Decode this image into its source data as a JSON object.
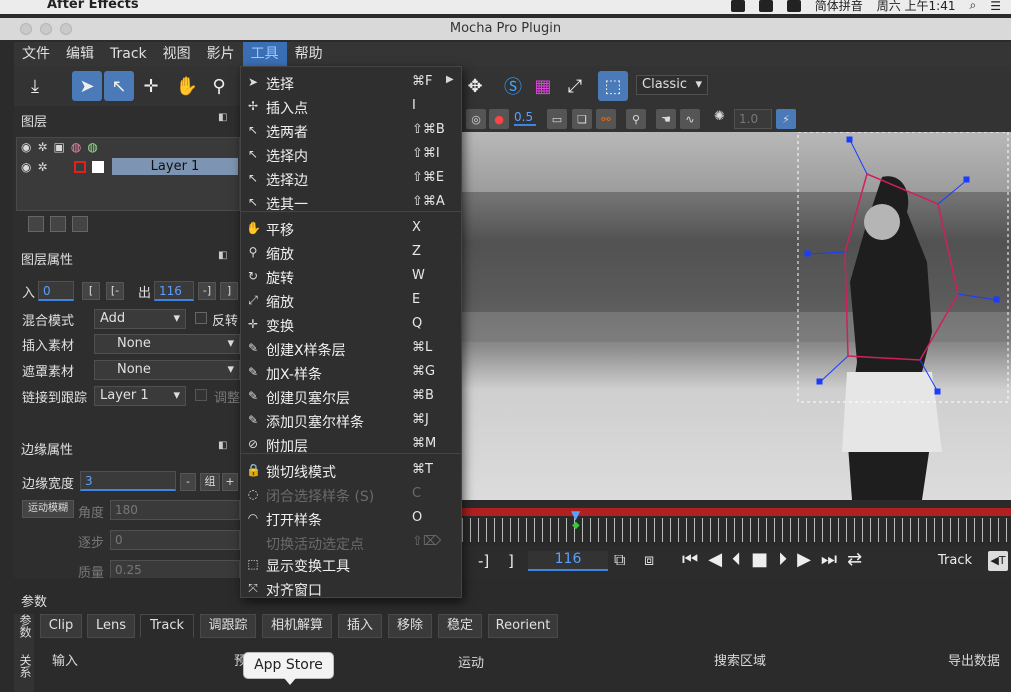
{
  "macos": {
    "app_name": "After Effects",
    "input_method": "简体拼音",
    "clock": "周六 上午1:41"
  },
  "window": {
    "title": "Mocha Pro Plugin"
  },
  "app_menu": [
    "文件",
    "编辑",
    "Track",
    "视图",
    "影片",
    "工具",
    "帮助"
  ],
  "toolbar": {
    "view_mode": "Classic",
    "opacity_value": "0.5",
    "exposure_value": "1.0"
  },
  "layers_panel": {
    "title": "图层",
    "layer_name": "Layer 1"
  },
  "layer_props": {
    "title": "图层属性",
    "in_label": "入",
    "in_value": "0",
    "out_label": "出",
    "out_value": "116",
    "blend_label": "混合模式",
    "blend_value": "Add",
    "invert_label": "反转",
    "insert_label": "插入素材",
    "insert_value": "None",
    "matte_label": "遮罩素材",
    "matte_value": "None",
    "link_label": "链接到跟踪",
    "link_value": "Layer 1",
    "adjust_label": "调整"
  },
  "edge_props": {
    "title": "边缘属性",
    "width_label": "边缘宽度",
    "width_value": "3",
    "minus": "-",
    "group": "组",
    "plus": "+",
    "motion_blur": "运动模糊",
    "angle_label": "角度",
    "angle_value": "180",
    "step_label": "逐步",
    "step_value": "0",
    "quality_label": "质量",
    "quality_value": "0.25"
  },
  "tools_menu": {
    "items": [
      {
        "label": "选择",
        "shortcut": "⌘F",
        "icon": "arrow-icon",
        "submenu": true
      },
      {
        "label": "插入点",
        "shortcut": "I",
        "icon": "insert-point-icon"
      },
      {
        "label": "选两者",
        "shortcut": "⇧⌘B",
        "icon": "select-both-icon"
      },
      {
        "label": "选择内",
        "shortcut": "⇧⌘I",
        "icon": "select-inner-icon"
      },
      {
        "label": "选择边",
        "shortcut": "⇧⌘E",
        "icon": "select-edge-icon"
      },
      {
        "label": "选其一",
        "shortcut": "⇧⌘A",
        "icon": "select-one-icon"
      },
      {
        "label": "平移",
        "shortcut": "X",
        "icon": "hand-icon"
      },
      {
        "label": "缩放",
        "shortcut": "Z",
        "icon": "zoom-icon"
      },
      {
        "label": "旋转",
        "shortcut": "W",
        "icon": "rotate-icon"
      },
      {
        "label": "缩放",
        "shortcut": "E",
        "icon": "scale-icon"
      },
      {
        "label": "变换",
        "shortcut": "Q",
        "icon": "move-icon"
      },
      {
        "label": "创建X样条层",
        "shortcut": "⌘L",
        "icon": "create-x-spline-icon"
      },
      {
        "label": "加X-样条",
        "shortcut": "⌘G",
        "icon": "add-x-spline-icon"
      },
      {
        "label": "创建贝塞尔层",
        "shortcut": "⌘B",
        "icon": "create-bezier-icon"
      },
      {
        "label": "添加贝塞尔样条",
        "shortcut": "⌘J",
        "icon": "add-bezier-icon"
      },
      {
        "label": "附加层",
        "shortcut": "⌘M",
        "icon": "attach-layer-icon"
      },
      {
        "label": "锁切线模式",
        "shortcut": "⌘T",
        "icon": "lock-icon"
      },
      {
        "label": "闭合选择样条 (S)",
        "shortcut": "C",
        "icon": "close-spline-icon",
        "disabled": true
      },
      {
        "label": "打开样条",
        "shortcut": "O",
        "icon": "open-spline-icon"
      },
      {
        "label": "切换活动选定点",
        "shortcut": "⇧⌦",
        "icon": "",
        "disabled": true
      },
      {
        "label": "显示变换工具",
        "shortcut": "",
        "icon": "transform-box-icon"
      },
      {
        "label": "对齐窗口",
        "shortcut": "",
        "icon": "align-window-icon"
      }
    ]
  },
  "transport": {
    "frame": "116",
    "track_label": "Track"
  },
  "bottom": {
    "title": "参数",
    "tabs": [
      "Clip",
      "Lens",
      "Track",
      "调跟踪",
      "相机解算",
      "插入",
      "移除",
      "稳定",
      "Reorient"
    ],
    "sections": [
      "输入",
      "预处理",
      "运动",
      "搜索区域",
      "导出数据"
    ],
    "side_tabs": [
      "参数",
      "关系"
    ]
  },
  "tooltip": "App Store"
}
